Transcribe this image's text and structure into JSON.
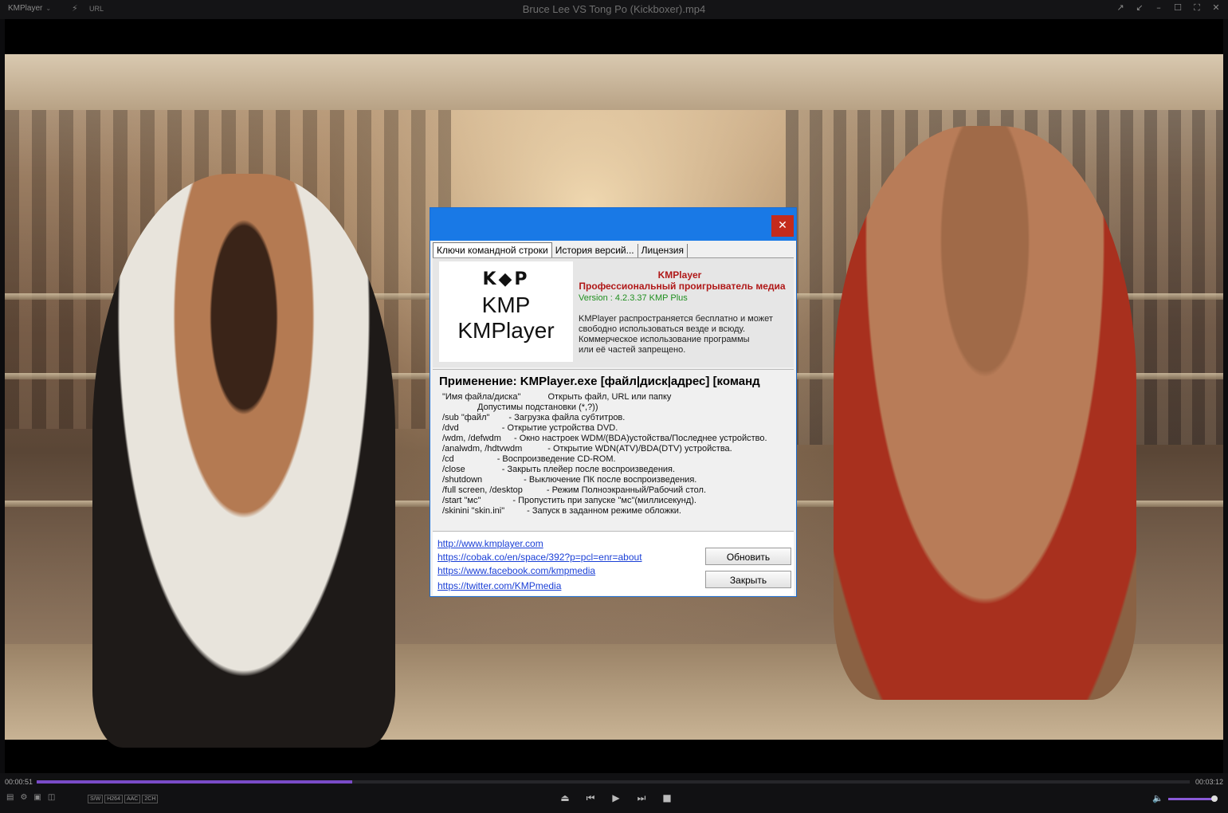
{
  "titlebar": {
    "app_logo": "KMPlayer",
    "url_label": "URL",
    "title": "Bruce Lee VS Tong Po (Kickboxer).mp4"
  },
  "dialog": {
    "tabs": [
      {
        "label": "Ключи командной строки",
        "active": true
      },
      {
        "label": "История версий...",
        "active": false
      },
      {
        "label": "Лицензия",
        "active": false
      }
    ],
    "logo_mark": "K◆P",
    "logo_kmp": "KMP",
    "logo_name": "KMPlayer",
    "app_name": "KMPlayer",
    "app_desc": "Профессиональный проигрыватель медиа",
    "version": "Version : 4.2.3.37 KMP Plus",
    "free_text": [
      "KMPlayer распространяется бесплатно и может",
      "свободно использоваться везде и всюду.",
      "Коммерческое использование программы",
      "или её частей запрещено."
    ],
    "usage": "Применение: KMPlayer.exe   [файл|диск|адрес] [команд",
    "commands": [
      {
        "key": "\"Имя файла/диска\"",
        "desc": "Открыть файл, URL или папку",
        "gap": 34
      },
      {
        "key": "",
        "desc": "Допустимы подстановки (*,?))",
        "gap": 44
      },
      {
        "key": "/sub \"файл\"",
        "desc": "- Загрузка файла субтитров.",
        "gap": 24
      },
      {
        "key": "/dvd",
        "desc": "- Открытие устройства DVD.",
        "gap": 54
      },
      {
        "key": "/wdm, /defwdm",
        "desc": "- Окно настроек WDM/(BDA)устойства/Последнее устройство.",
        "gap": 16
      },
      {
        "key": "/analwdm, /hdtvwdm",
        "desc": "- Открытие WDN(ATV)/BDA(DTV) устройства.",
        "gap": 32
      },
      {
        "key": "/cd",
        "desc": "- Воспроизведение CD-ROM.",
        "gap": 54
      },
      {
        "key": "/close",
        "desc": "- Закрыть плейер после воспроизведения.",
        "gap": 46
      },
      {
        "key": "/shutdown",
        "desc": "- Выключение ПК после воспроизведения.",
        "gap": 52
      },
      {
        "key": "/full screen, /desktop",
        "desc": "- Режим Полноэкранный/Рабочий стол.",
        "gap": 30
      },
      {
        "key": "/start \"мс\"",
        "desc": "- Пропустить при запуске \"мс\"(миллисекунд).",
        "gap": 40
      },
      {
        "key": "/skinini \"skin.ini\"",
        "desc": "- Запуск в заданном режиме обложки.",
        "gap": 28
      }
    ],
    "links": [
      "http://www.kmplayer.com",
      "https://cobak.co/en/space/392?p=pcl=enr=about",
      "https://www.facebook.com/kmpmedia",
      "https://twitter.com/KMPmedia"
    ],
    "update_button": "Обновить",
    "close_button": "Закрыть",
    "close_glyph": "✕"
  },
  "playback": {
    "current_time": "00:00:51",
    "total_time": "00:03:12",
    "progress": 0.274,
    "volume": 1.0,
    "badges": [
      "S/W",
      "H264",
      "AAC",
      "2CH"
    ]
  },
  "colors": {
    "accent": "#7a4cc8",
    "dialog_caption": "#1979e6",
    "close_red": "#c42b1c",
    "app_name_red": "#b01818",
    "version_green": "#1f8f1f",
    "link_blue": "#1a3fd6"
  },
  "icons": {
    "titlebar_controls": [
      "pin-icon",
      "compact-icon",
      "minimize-icon",
      "maximize-icon",
      "fullscreen-icon",
      "close-icon"
    ],
    "playback_controls": [
      "eject-icon",
      "previous-icon",
      "play-icon",
      "next-icon",
      "stop-icon"
    ]
  }
}
